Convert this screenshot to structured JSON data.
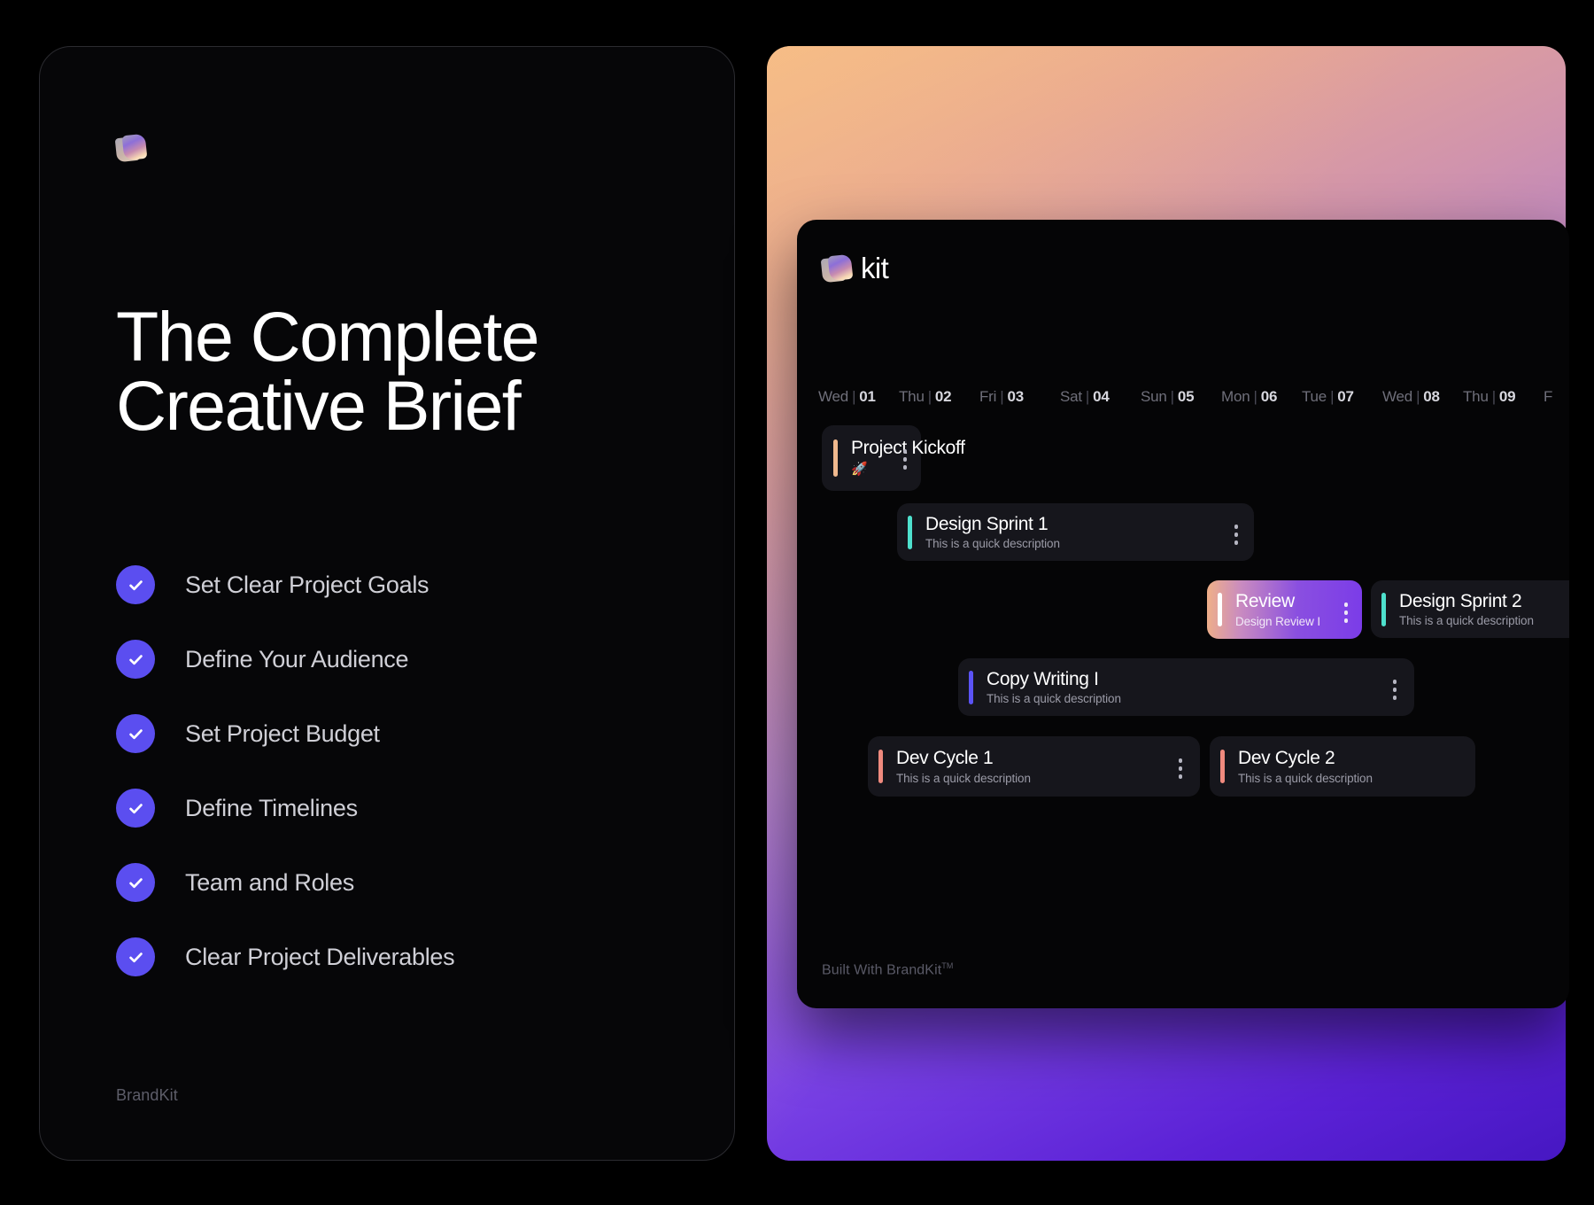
{
  "brief": {
    "logo_icon": "brandkit-gradient-logo",
    "title_line1": "The Complete",
    "title_line2": "Creative Brief",
    "checklist": [
      {
        "label": "Set Clear Project Goals",
        "icon": "check-icon"
      },
      {
        "label": "Define Your Audience",
        "icon": "check-icon"
      },
      {
        "label": "Set Project Budget",
        "icon": "check-icon"
      },
      {
        "label": "Define Timelines",
        "icon": "check-icon"
      },
      {
        "label": "Team and Roles",
        "icon": "check-icon"
      },
      {
        "label": "Clear Project Deliverables",
        "icon": "check-icon"
      }
    ],
    "footer": "BrandKit",
    "accent_color": "#5b4ef0",
    "background_color": "#060608",
    "border_color": "#2b2b30"
  },
  "promo": {
    "gradient_from": "#f6bd86",
    "gradient_mid": "#a878d4",
    "gradient_to": "#4617c2"
  },
  "app": {
    "brand_name": "kit",
    "brand_icon": "brandkit-gradient-logo",
    "background_color": "#050506",
    "dates": [
      {
        "day": "Wed",
        "sep": "|",
        "num": "01"
      },
      {
        "day": "Thu",
        "sep": "|",
        "num": "02"
      },
      {
        "day": "Fri",
        "sep": "|",
        "num": "03"
      },
      {
        "day": "Sat",
        "sep": "|",
        "num": "04"
      },
      {
        "day": "Sun",
        "sep": "|",
        "num": "05"
      },
      {
        "day": "Mon",
        "sep": "|",
        "num": "06"
      },
      {
        "day": "Tue",
        "sep": "|",
        "num": "07"
      },
      {
        "day": "Wed",
        "sep": "|",
        "num": "08"
      },
      {
        "day": "Thu",
        "sep": "|",
        "num": "09"
      },
      {
        "day": "F",
        "sep": "",
        "num": ""
      }
    ],
    "tasks": [
      {
        "title": "Project Kickoff",
        "description": "",
        "emoji": "🚀",
        "accent_color": "#f0b98e",
        "menu_icon": "more-vertical-icon",
        "highlighted": false
      },
      {
        "title": "Design Sprint 1",
        "description": "This is a quick description",
        "emoji": "",
        "accent_color": "#4ee0cd",
        "menu_icon": "more-vertical-icon",
        "highlighted": false
      },
      {
        "title": "Review",
        "description": "Design Review I",
        "emoji": "",
        "accent_color": "#ffffff",
        "menu_icon": "more-vertical-icon",
        "highlighted": true
      },
      {
        "title": "Design Sprint 2",
        "description": "This is a quick description",
        "emoji": "",
        "accent_color": "#4ee0cd",
        "menu_icon": "more-vertical-icon",
        "highlighted": false
      },
      {
        "title": "Copy Writing I",
        "description": "This is a quick description",
        "emoji": "",
        "accent_color": "#5b53f5",
        "menu_icon": "more-vertical-icon",
        "highlighted": false
      },
      {
        "title": "Dev Cycle 1",
        "description": "This is a quick description",
        "emoji": "",
        "accent_color": "#f08a7e",
        "menu_icon": "more-vertical-icon",
        "highlighted": false
      },
      {
        "title": "Dev Cycle 2",
        "description": "This is a quick description",
        "emoji": "",
        "accent_color": "#f08a7e",
        "menu_icon": "more-vertical-icon",
        "highlighted": false
      }
    ],
    "footer_text": "Built With BrandKit",
    "footer_mark": "TM"
  }
}
